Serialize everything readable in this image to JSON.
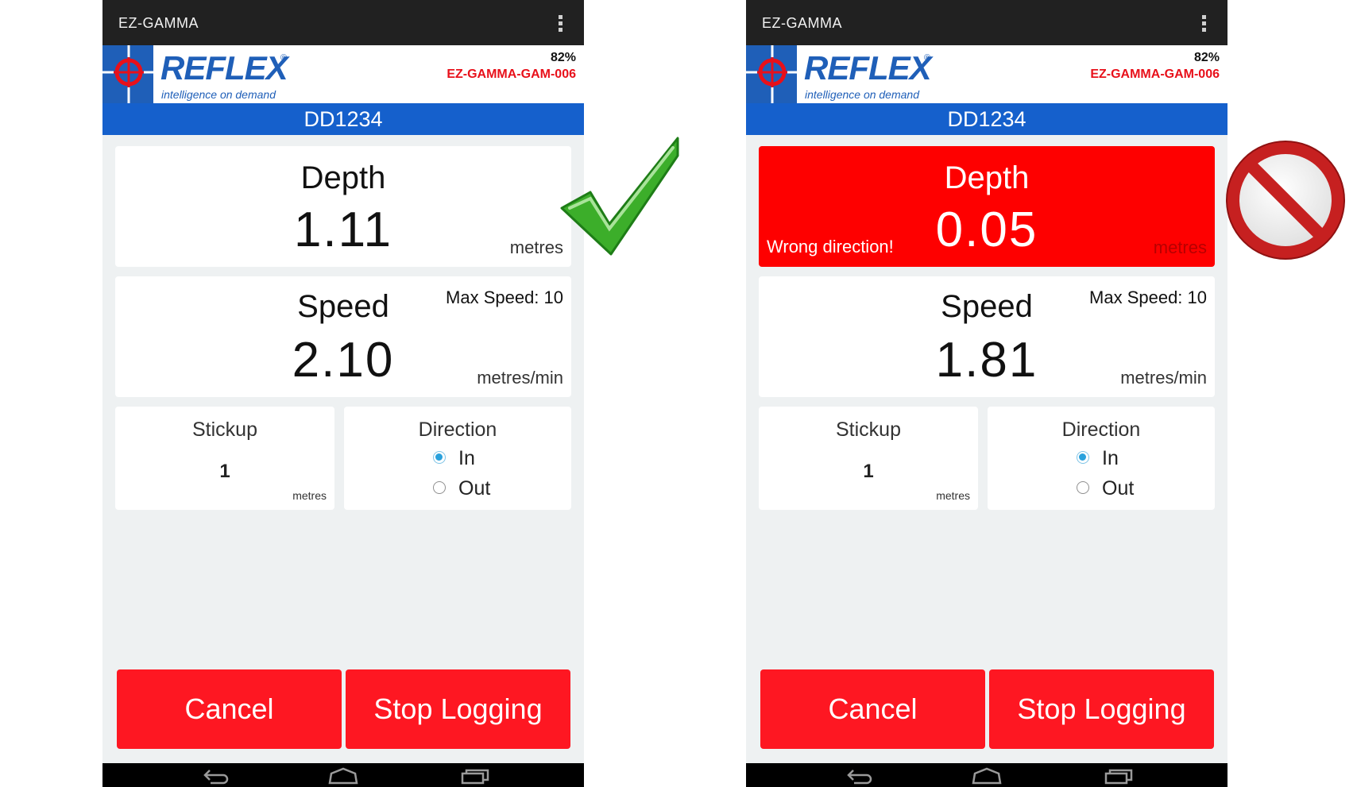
{
  "left_screen": {
    "app_title": "EZ-GAMMA",
    "brand": {
      "word": "REFLEX",
      "reg": "®",
      "tagline": "intelligence on demand"
    },
    "battery": "82%",
    "device_id": "EZ-GAMMA-GAM-006",
    "hole_id": "DD1234",
    "depth": {
      "title": "Depth",
      "value": "1.11",
      "unit": "metres",
      "alert": false
    },
    "speed": {
      "title": "Speed",
      "value": "2.10",
      "unit": "metres/min",
      "max": "Max Speed: 10"
    },
    "stickup": {
      "title": "Stickup",
      "value": "1",
      "unit": "metres"
    },
    "direction": {
      "title": "Direction",
      "options": [
        "In",
        "Out"
      ],
      "selected": "In"
    },
    "buttons": {
      "cancel": "Cancel",
      "stop": "Stop Logging"
    },
    "indicator": "check-icon",
    "colors": {
      "accent_red": "#fe1722",
      "hole_bar": "#1560cc",
      "check_green": "#3cae2a"
    }
  },
  "right_screen": {
    "app_title": "EZ-GAMMA",
    "brand": {
      "word": "REFLEX",
      "reg": "®",
      "tagline": "intelligence on demand"
    },
    "battery": "82%",
    "device_id": "EZ-GAMMA-GAM-006",
    "hole_id": "DD1234",
    "depth": {
      "title": "Depth",
      "value": "0.05",
      "unit": "metres",
      "alert": true,
      "alert_message": "Wrong direction!"
    },
    "speed": {
      "title": "Speed",
      "value": "1.81",
      "unit": "metres/min",
      "max": "Max Speed: 10"
    },
    "stickup": {
      "title": "Stickup",
      "value": "1",
      "unit": "metres"
    },
    "direction": {
      "title": "Direction",
      "options": [
        "In",
        "Out"
      ],
      "selected": "In"
    },
    "buttons": {
      "cancel": "Cancel",
      "stop": "Stop Logging"
    },
    "indicator": "prohibited-icon",
    "colors": {
      "alert_red": "#fe0000",
      "prohibited_red": "#c62020"
    }
  }
}
